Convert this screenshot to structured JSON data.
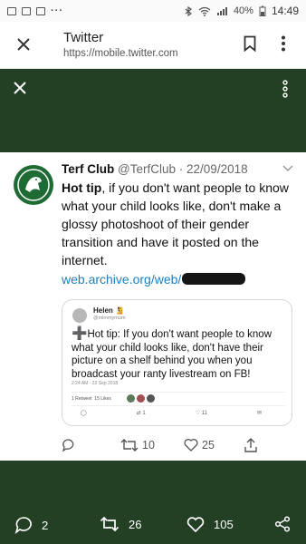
{
  "status": {
    "battery": "40%",
    "time": "14:49"
  },
  "browser": {
    "title": "Twitter",
    "url": "https://mobile.twitter.com"
  },
  "tweet": {
    "name": "Terf Club",
    "handle": "@TerfClub",
    "separator": "·",
    "date": "22/09/2018",
    "bold_lead": "Hot tip",
    "text": ", if you don't want people to know what your child looks like, don't make a glossy photoshoot of their gender transition and have it posted on the internet.",
    "link": "web.archive.org/web/",
    "actions": {
      "reply": "",
      "retweets": "10",
      "likes": "25"
    }
  },
  "quoted": {
    "name": "Helen",
    "handle": "@mimmymum",
    "plus": "➕",
    "text": "Hot tip: If you don't want people to know what your child looks like, don't have their picture on a shelf behind you when you broadcast your ranty livestream on FB!",
    "date": "2:24 AM - 22 Sep 2018",
    "retweets": "1 Retweet",
    "likes": "15 Likes",
    "action_rt": "1",
    "action_likes": "11"
  },
  "bottom": {
    "replies": "2",
    "retweets": "26",
    "likes": "105"
  },
  "colors": {
    "header_green": "#234025",
    "link": "#1b7fbf"
  }
}
